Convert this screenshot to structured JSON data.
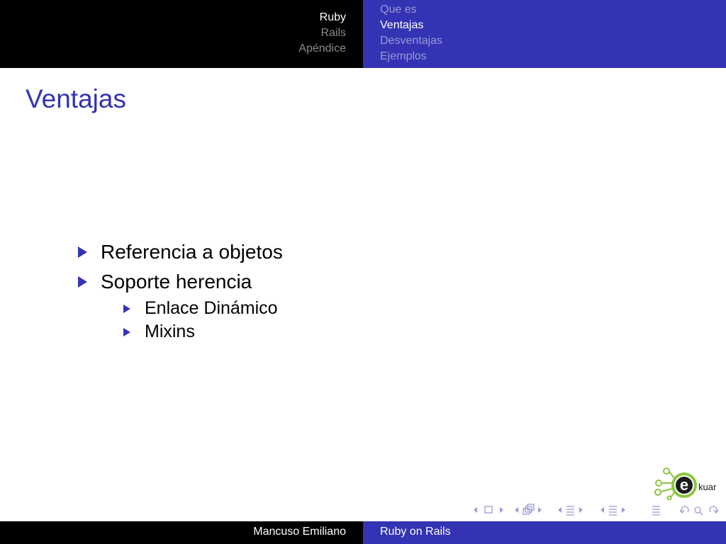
{
  "header": {
    "sections": [
      {
        "label": "Ruby",
        "active": true
      },
      {
        "label": "Rails",
        "active": false
      },
      {
        "label": "Apéndice",
        "active": false
      }
    ],
    "subsections": [
      {
        "label": "Que es",
        "active": false
      },
      {
        "label": "Ventajas",
        "active": true
      },
      {
        "label": "Desventajas",
        "active": false
      },
      {
        "label": "Ejemplos",
        "active": false
      }
    ]
  },
  "frame": {
    "title": "Ventajas",
    "items": [
      {
        "text": "Referencia a objetos",
        "level": 1
      },
      {
        "text": "Soporte herencia",
        "level": 1
      },
      {
        "text": "Enlace Dinámico",
        "level": 2
      },
      {
        "text": "Mixins",
        "level": 2
      }
    ]
  },
  "logo": {
    "text": "kuar",
    "letter": "e"
  },
  "footer": {
    "author": "Mancuso Emiliano",
    "title": "Ruby on Rails"
  },
  "colors": {
    "accent": "#3333b3",
    "header_left": "#000000",
    "inactive_text": "#8a8a8a",
    "logo_green": "#8dc63f"
  },
  "nav_icons": [
    "nav-prev-icon",
    "nav-frame-icon",
    "nav-next-icon",
    "nav-subsection-icon",
    "nav-section-icon",
    "nav-document-icon",
    "nav-align-icon",
    "nav-back-icon",
    "nav-search-icon",
    "nav-forward-icon"
  ]
}
